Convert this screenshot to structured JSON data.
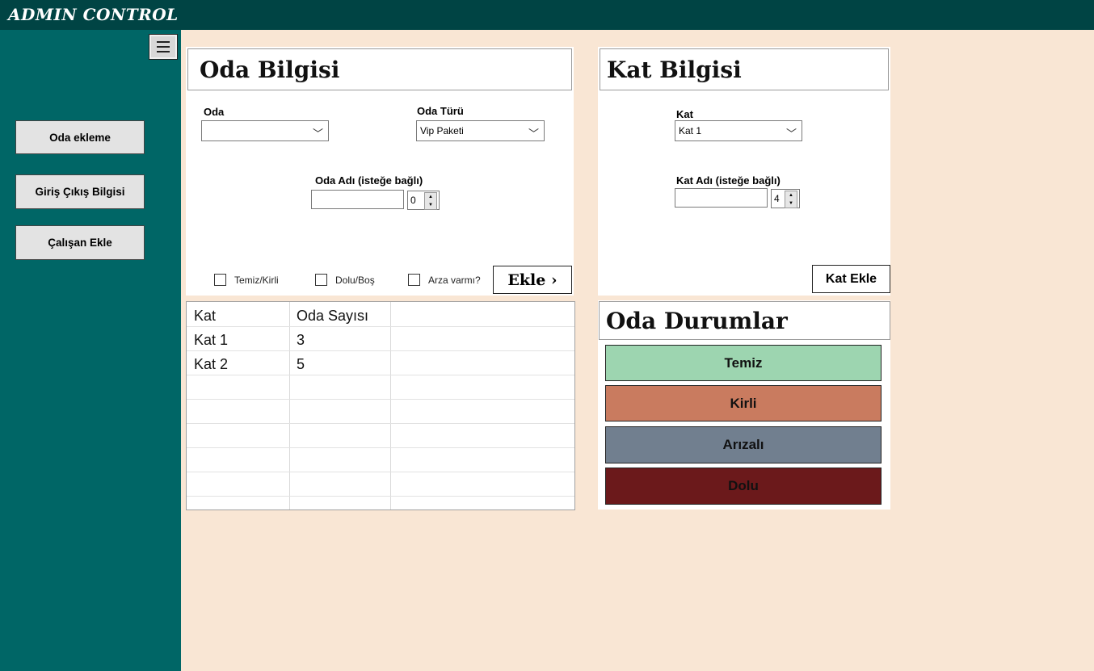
{
  "app": {
    "title": "ADMIN CONTROL"
  },
  "sidebar": {
    "items": [
      {
        "label": "Oda ekleme"
      },
      {
        "label": "Giriş Çıkış Bilgisi"
      },
      {
        "label": "Çalışan  Ekle"
      }
    ]
  },
  "oda_bilgisi": {
    "title": "Oda Bilgisi",
    "oda_label": "Oda",
    "oda_value": "",
    "tur_label": "Oda Türü",
    "tur_value": "Vip Paketi",
    "ad_label": "Oda Adı (isteğe bağlı)",
    "ad_value": "",
    "number_value": "0",
    "checkboxes": [
      {
        "label": "Temiz/Kirli",
        "checked": false
      },
      {
        "label": "Dolu/Boş",
        "checked": false
      },
      {
        "label": "Arza varmı?",
        "checked": false
      }
    ],
    "add_button": "Ekle ›"
  },
  "kat_bilgisi": {
    "title": "Kat Bilgisi",
    "kat_label": "Kat",
    "kat_value": "Kat 1",
    "ad_label": "Kat Adı (isteğe bağlı)",
    "ad_value": "",
    "number_value": "4",
    "add_button": "Kat Ekle"
  },
  "table": {
    "headers": [
      "Kat",
      "Oda Sayısı"
    ],
    "rows": [
      [
        "Kat 1",
        "3"
      ],
      [
        "Kat 2",
        "5"
      ]
    ]
  },
  "oda_durumlar": {
    "title": "Oda Durumlar",
    "buttons": [
      {
        "label": "Temiz",
        "color": "#9dd5b0"
      },
      {
        "label": "Kirli",
        "color": "#c97b5f"
      },
      {
        "label": "Arızalı",
        "color": "#717f8f"
      },
      {
        "label": "Dolu",
        "color": "#6b191b"
      }
    ]
  }
}
